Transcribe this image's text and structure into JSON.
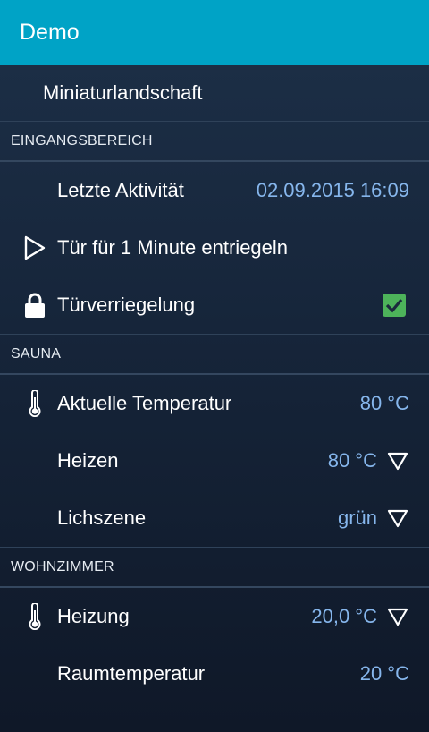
{
  "appbar": {
    "title": "Demo"
  },
  "subheader": {
    "title": "Miniaturlandschaft"
  },
  "sections": {
    "eingang": {
      "title": "EINGANGSBEREICH",
      "letzte_aktivitaet": {
        "label": "Letzte Aktivität",
        "value": "02.09.2015 16:09"
      },
      "tuer_entriegeln": {
        "label": "Tür für 1 Minute entriegeln",
        "icon": "play-outline-icon"
      },
      "tuerverriegelung": {
        "label": "Türverriegelung",
        "icon": "lock-icon",
        "checked": true
      }
    },
    "sauna": {
      "title": "SAUNA",
      "aktuelle_temperatur": {
        "label": "Aktuelle Temperatur",
        "value": "80 °C",
        "icon": "thermometer-icon"
      },
      "heizen": {
        "label": "Heizen",
        "value": "80 °C"
      },
      "lichszene": {
        "label": "Lichszene",
        "value": "grün"
      }
    },
    "wohnzimmer": {
      "title": "WOHNZIMMER",
      "heizung": {
        "label": "Heizung",
        "value": "20,0 °C",
        "icon": "thermometer-icon"
      },
      "raumtemperatur": {
        "label": "Raumtemperatur",
        "value": "20 °C"
      }
    }
  },
  "colors": {
    "appbar": "#00a3c6",
    "value": "#86b6ec",
    "checkbox": "#4db35a"
  }
}
